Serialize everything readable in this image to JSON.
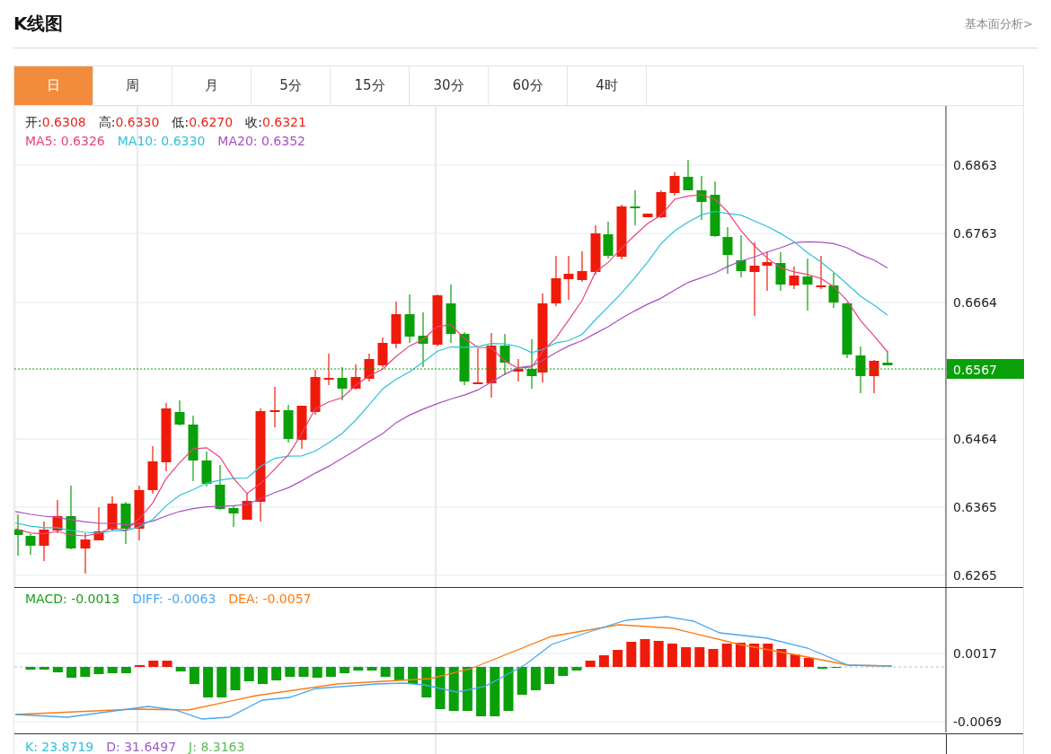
{
  "header": {
    "title": "K线图",
    "link": "基本面分析>"
  },
  "tabs": [
    {
      "label": "日",
      "selected": true
    },
    {
      "label": "周",
      "selected": false
    },
    {
      "label": "月",
      "selected": false
    },
    {
      "label": "5分",
      "selected": false
    },
    {
      "label": "15分",
      "selected": false
    },
    {
      "label": "30分",
      "selected": false
    },
    {
      "label": "60分",
      "selected": false
    },
    {
      "label": "4时",
      "selected": false
    }
  ],
  "quote": [
    {
      "label": "开:",
      "value": "0.6308"
    },
    {
      "label": "高:",
      "value": "0.6330"
    },
    {
      "label": "低:",
      "value": "0.6270"
    },
    {
      "label": "收:",
      "value": "0.6321"
    }
  ],
  "ma": [
    {
      "text": "MA5: 0.6326",
      "color": "#e8437a"
    },
    {
      "text": "MA10: 0.6330",
      "color": "#2ec1d8"
    },
    {
      "text": "MA20: 0.6352",
      "color": "#a950c2"
    }
  ],
  "price_axis": [
    "0.6863",
    "0.6763",
    "0.6664",
    "0.6567",
    "0.6464",
    "0.6365",
    "0.6265"
  ],
  "macd": {
    "labels": [
      {
        "text": "MACD: -0.0013",
        "color": "#1a9e1a"
      },
      {
        "text": "DIFF: -0.0063",
        "color": "#4aa8f0"
      },
      {
        "text": "DEA: -0.0057",
        "color": "#ff7a10"
      }
    ],
    "axis": [
      "0.0017",
      "-0.0069"
    ]
  },
  "kdj": {
    "labels": [
      {
        "text": "K: 23.8719",
        "color": "#2ec1d8"
      },
      {
        "text": "D: 31.6497",
        "color": "#9a5cc8"
      },
      {
        "text": "J: 8.3163",
        "color": "#5cb85c"
      }
    ]
  }
}
